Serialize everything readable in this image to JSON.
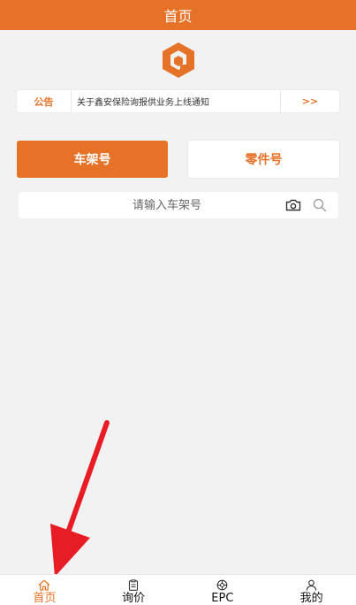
{
  "header": {
    "title": "首页"
  },
  "notice": {
    "tag": "公告",
    "text": "关于鑫安保险询报供业务上线通知",
    "more": ">>"
  },
  "modes": {
    "vin_label": "车架号",
    "part_label": "零件号",
    "active": "vin"
  },
  "search": {
    "placeholder": "请输入车架号",
    "value": ""
  },
  "tabbar": {
    "items": [
      {
        "label": "首页",
        "icon": "home-icon",
        "active": true
      },
      {
        "label": "询价",
        "icon": "clipboard-icon",
        "active": false
      },
      {
        "label": "EPC",
        "icon": "gear-icon",
        "active": false
      },
      {
        "label": "我的",
        "icon": "person-icon",
        "active": false
      }
    ]
  },
  "colors": {
    "accent": "#e67228",
    "background": "#f2f2f2",
    "annotation_arrow": "#e81c24"
  }
}
